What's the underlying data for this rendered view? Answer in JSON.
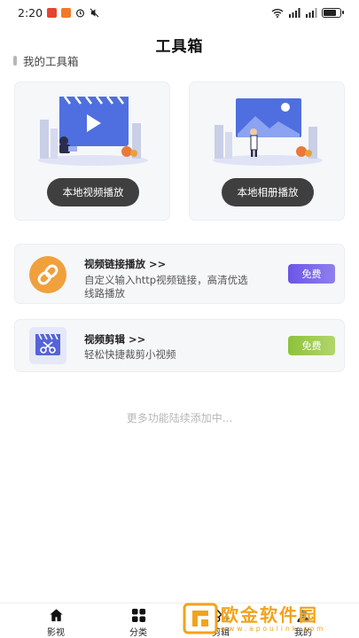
{
  "status_bar": {
    "time": "2:20",
    "battery_level": 0.8,
    "icons": [
      "notification-red-icon",
      "notification-orange-icon",
      "alarm-icon",
      "mute-icon",
      "wifi-icon",
      "signal-icon",
      "signal-icon",
      "battery-icon"
    ]
  },
  "page": {
    "title": "工具箱"
  },
  "section": {
    "title": "我的工具箱"
  },
  "cards": {
    "local_video": {
      "button_label": "本地视频播放"
    },
    "local_album": {
      "button_label": "本地相册播放"
    }
  },
  "rows": {
    "link_play": {
      "title": "视频链接播放 >>",
      "description": "自定义输入http视频链接，高清优选线路播放",
      "badge": "免费"
    },
    "video_edit": {
      "title": "视频剪辑 >>",
      "description": "轻松快捷裁剪小视频",
      "badge": "免费"
    }
  },
  "more_text": "更多功能陆续添加中...",
  "tabbar": {
    "tabs": [
      {
        "label": "影视",
        "icon": "home-icon"
      },
      {
        "label": "分类",
        "icon": "grid-icon"
      },
      {
        "label": "剪辑",
        "icon": "scissors-icon"
      },
      {
        "label": "我的",
        "icon": "user-icon"
      }
    ]
  },
  "watermark": {
    "text": "欧金软件园",
    "sub": "www.apoulink.com"
  },
  "colors": {
    "accent_purple": "#6b56e6",
    "accent_green": "#8dc23a",
    "button_dark": "#3f3f3f",
    "watermark": "#f2a31b"
  }
}
